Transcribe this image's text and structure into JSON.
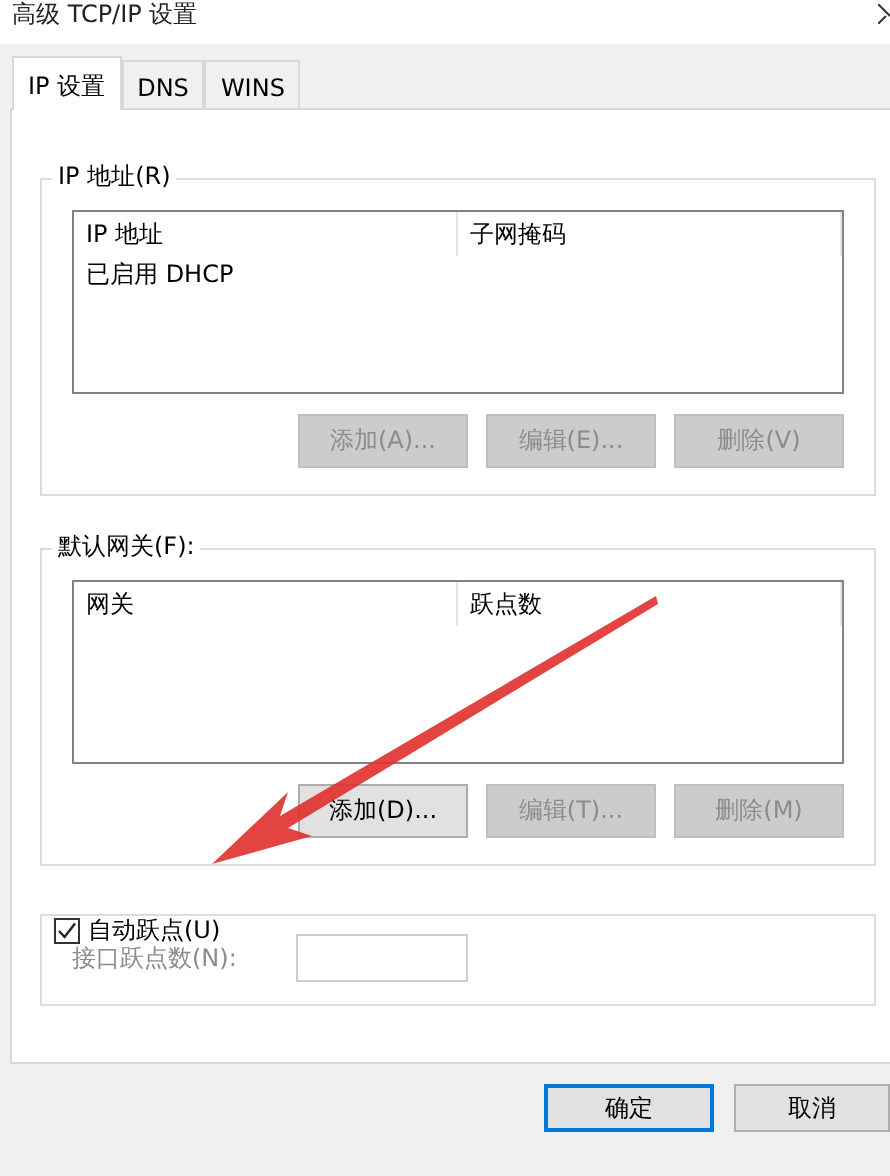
{
  "window": {
    "title": "高级 TCP/IP 设置"
  },
  "tabs": [
    {
      "label": "IP 设置",
      "selected": true
    },
    {
      "label": "DNS",
      "selected": false
    },
    {
      "label": "WINS",
      "selected": false
    }
  ],
  "ip_addresses": {
    "label": "IP 地址(R)",
    "columns": [
      "IP 地址",
      "子网掩码"
    ],
    "rows": [
      [
        "已启用 DHCP"
      ]
    ],
    "buttons": [
      {
        "label": "添加(A)...",
        "disabled": true
      },
      {
        "label": "编辑(E)...",
        "disabled": true
      },
      {
        "label": "删除(V)",
        "disabled": true
      }
    ]
  },
  "default_gateways": {
    "label": "默认网关(F):",
    "columns": [
      "网关",
      "跃点数"
    ],
    "buttons": [
      {
        "label": "添加(D)...",
        "disabled": false
      },
      {
        "label": "编辑(T)...",
        "disabled": true
      },
      {
        "label": "删除(M)",
        "disabled": true
      }
    ]
  },
  "automatic_metric": {
    "label": "自动跃点(U)",
    "checked": true,
    "interface_metric": {
      "label": "接口跃点数(N):",
      "disabled": true
    }
  },
  "buttons": [
    {
      "label": "确定",
      "default": true
    },
    {
      "label": "取消",
      "default": false
    }
  ]
}
